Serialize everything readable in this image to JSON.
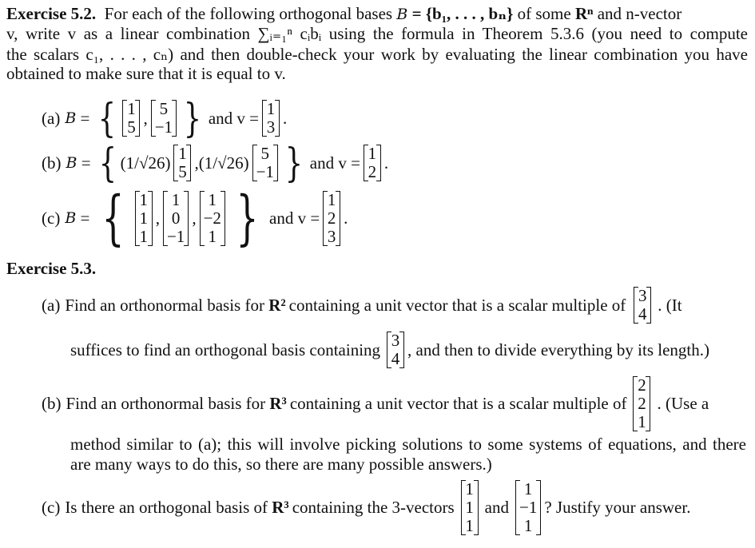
{
  "ex52": {
    "heading": "Exercise 5.2.",
    "lines": [
      "For each of the following orthogonal bases",
      "of some",
      "and",
      "-vector"
    ],
    "intro_line1_prefix": "For each of the following orthogonal bases ",
    "basis_symbol": "B",
    "basis_set": "= {b₁, . . . , bₙ}",
    "intro_line1_mid": " of some ",
    "Rn": "Rⁿ",
    "intro_line1_end": " and n-vector",
    "line2": "v, write v as a linear combination ∑ᵢ₌₁ⁿ cᵢbᵢ using the formula in Theorem 5.3.6 (you need to compute",
    "line3": "the scalars c₁, . . . , cₙ) and then double-check your work by evaluating the linear combination you have",
    "line4": "obtained to make sure that it is equal to v.",
    "parts": [
      {
        "label": "(a)",
        "basis": [
          [
            "1",
            "5"
          ],
          [
            "5",
            "−1"
          ]
        ],
        "scalar": "",
        "v": [
          "1",
          "3"
        ]
      },
      {
        "label": "(b)",
        "basis": [
          [
            "1",
            "5"
          ],
          [
            "5",
            "−1"
          ]
        ],
        "scalar": "(1/√26)",
        "v": [
          "1",
          "2"
        ]
      },
      {
        "label": "(c)",
        "basis": [
          [
            "1",
            "1",
            "1"
          ],
          [
            "1",
            "0",
            "−1"
          ],
          [
            "1",
            "−2",
            "1"
          ]
        ],
        "scalar": "",
        "v": [
          "1",
          "2",
          "3"
        ]
      }
    ],
    "eq_text": "=",
    "and_v": "and v =",
    "period": "."
  },
  "ex53": {
    "heading": "Exercise 5.3.",
    "a": {
      "label": "(a)",
      "line1_pre": "Find an orthonormal basis for ",
      "space": "R²",
      "line1_post": " containing a unit vector that is a scalar multiple of",
      "vec": [
        "3",
        "4"
      ],
      "line1_tail": ". (It",
      "line2_pre": "suffices to find an orthogonal basis containing",
      "line2_post": ", and then to divide everything by its length.)"
    },
    "b": {
      "label": "(b)",
      "line1_pre": "Find an orthonormal basis for ",
      "space": "R³",
      "line1_post": " containing a unit vector that is a scalar multiple of",
      "vec": [
        "2",
        "2",
        "1"
      ],
      "line1_tail": ". (Use a",
      "line2": "method similar to (a); this will involve picking solutions to some systems of equations, and there",
      "line3": "are many ways to do this, so there are many possible answers.)"
    },
    "c": {
      "label": "(c)",
      "line1_pre": "Is there an orthogonal basis of ",
      "space": "R³",
      "line1_mid": " containing the 3-vectors",
      "vec1": [
        "1",
        "1",
        "1"
      ],
      "and": "and",
      "vec2": [
        "1",
        "−1",
        "1"
      ],
      "line1_post": "? Justify your answer."
    }
  }
}
